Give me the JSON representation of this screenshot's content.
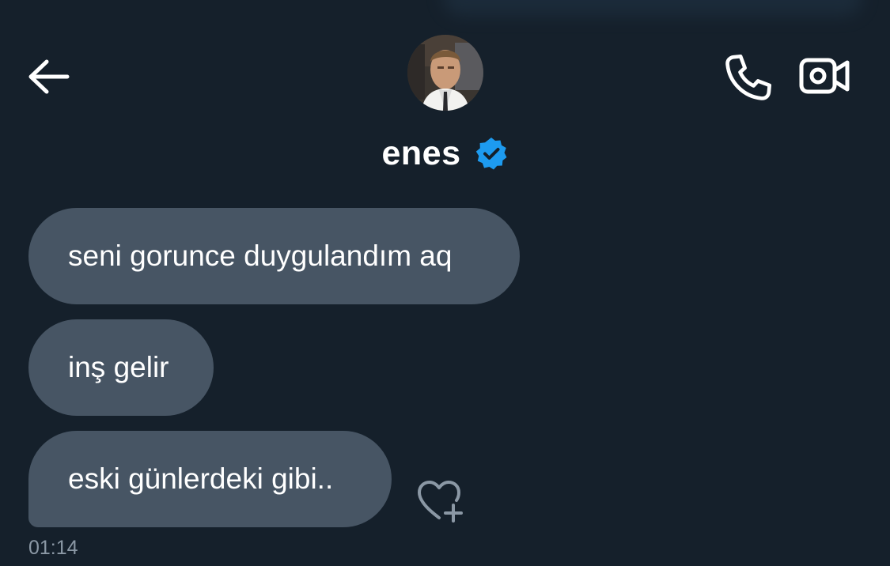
{
  "header": {
    "back_icon": "arrow-left-icon",
    "call_icon": "phone-icon",
    "video_icon": "video-camera-icon",
    "contact": {
      "name": "enes",
      "verified_icon": "verified-badge-icon",
      "avatar_icon": "avatar-photo"
    }
  },
  "messages": [
    {
      "text": "seni gorunce duygulandım aq"
    },
    {
      "text": "inş gelir"
    },
    {
      "text": "eski günlerdeki gibi.."
    }
  ],
  "timestamp": "01:14",
  "reaction_icon": "heart-plus-icon",
  "colors": {
    "background": "#15202b",
    "bubble": "#475564",
    "verified": "#1d9bf0",
    "muted_text": "#8b98a5",
    "icon": "#ffffff"
  }
}
